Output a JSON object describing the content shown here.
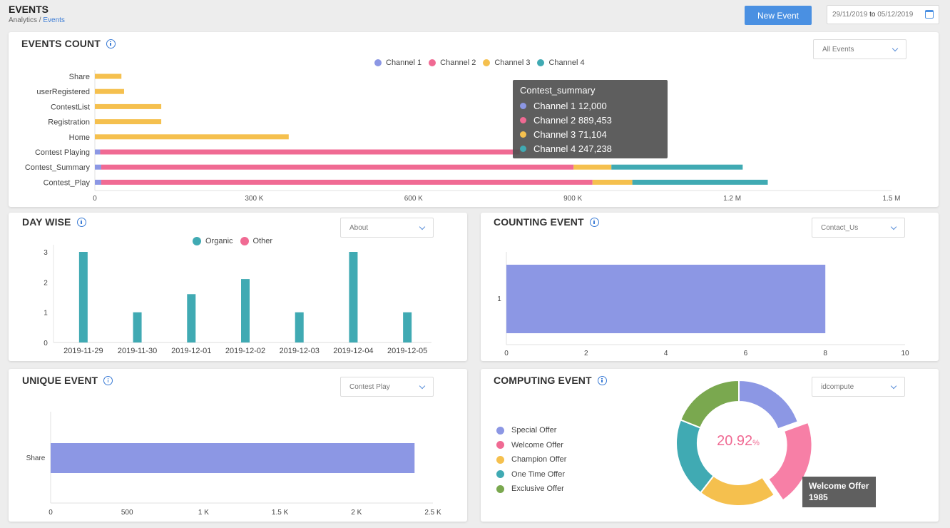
{
  "header": {
    "title": "EVENTS",
    "breadcrumb_root": "Analytics / ",
    "breadcrumb_current": "Events",
    "new_event_label": "New Event",
    "date_from": "29/11/2019",
    "date_to_word": "to",
    "date_to": "05/12/2019"
  },
  "colors": {
    "channel1": "#8c97e4",
    "channel2": "#f06a93",
    "channel3": "#f5c04e",
    "channel4": "#40aab3",
    "organic": "#40aab3",
    "other": "#f06a93",
    "bar_blue": "#8c97e4",
    "accent": "#4a90e2",
    "special": "#8c97e4",
    "welcome": "#f77fa6",
    "champion": "#f5c04e",
    "one_time": "#40aab3",
    "exclusive": "#7aa84f"
  },
  "events_count": {
    "title": "EVENTS COUNT",
    "select_value": "All Events",
    "tooltip": {
      "title": "Contest_summary",
      "rows": [
        {
          "name": "Channel 1",
          "value": "12,000"
        },
        {
          "name": "Channel 2",
          "value": "889,453"
        },
        {
          "name": "Channel 3",
          "value": "71,104"
        },
        {
          "name": "Channel 4",
          "value": "247,238"
        }
      ]
    }
  },
  "day_wise": {
    "title": "DAY WISE",
    "select_value": "About"
  },
  "counting_event": {
    "title": "COUNTING EVENT",
    "select_value": "Contact_Us"
  },
  "unique_event": {
    "title": "UNIQUE EVENT",
    "select_value": "Contest Play"
  },
  "computing_event": {
    "title": "COMPUTING EVENT",
    "select_value": "idcompute",
    "center_value": "20.92",
    "center_unit": "%",
    "tooltip_label": "Welcome Offer",
    "tooltip_value": "1985"
  },
  "chart_data": [
    {
      "type": "bar",
      "orientation": "horizontal",
      "stacked": true,
      "title": "EVENTS COUNT",
      "categories": [
        "Share",
        "userRegistered",
        "ContestList",
        "Registration",
        "Home",
        "Contest Playing",
        "Contest_Summary",
        "Contest_Play"
      ],
      "series": [
        {
          "name": "Channel 1",
          "values": [
            0,
            0,
            0,
            0,
            0,
            10000,
            12000,
            12000
          ]
        },
        {
          "name": "Channel 2",
          "values": [
            0,
            0,
            0,
            0,
            0,
            790000,
            889453,
            925000
          ]
        },
        {
          "name": "Channel 3",
          "values": [
            50000,
            55000,
            125000,
            125000,
            365000,
            0,
            71104,
            75000
          ]
        },
        {
          "name": "Channel 4",
          "values": [
            0,
            0,
            0,
            0,
            0,
            0,
            247238,
            255000
          ]
        }
      ],
      "xlim": [
        0,
        1500000
      ],
      "xticks": [
        "0",
        "300 K",
        "600 K",
        "900 K",
        "1.2 M",
        "1.5 M"
      ],
      "legend_position": "top"
    },
    {
      "type": "bar",
      "title": "DAY WISE",
      "categories": [
        "2019-11-29",
        "2019-11-30",
        "2019-12-01",
        "2019-12-02",
        "2019-12-03",
        "2019-12-04",
        "2019-12-05"
      ],
      "series": [
        {
          "name": "Organic",
          "values": [
            3,
            1,
            1.6,
            2.1,
            1,
            3,
            1
          ]
        },
        {
          "name": "Other",
          "values": [
            0,
            0,
            0,
            0,
            0,
            0,
            0
          ]
        }
      ],
      "ylim": [
        0,
        3
      ],
      "yticks": [
        "0",
        "1",
        "2",
        "3"
      ],
      "legend_position": "top"
    },
    {
      "type": "bar",
      "orientation": "horizontal",
      "title": "COUNTING EVENT",
      "categories": [
        "1"
      ],
      "values": [
        8
      ],
      "xlim": [
        0,
        10
      ],
      "xticks": [
        "0",
        "2",
        "4",
        "6",
        "8",
        "10"
      ]
    },
    {
      "type": "bar",
      "orientation": "horizontal",
      "title": "UNIQUE EVENT",
      "categories": [
        "Share"
      ],
      "values": [
        2380
      ],
      "xlim": [
        0,
        2500
      ],
      "xticks": [
        "0",
        "500",
        "1 K",
        "1.5 K",
        "2 K",
        "2.5 K"
      ]
    },
    {
      "type": "pie",
      "donut": true,
      "title": "COMPUTING EVENT",
      "labels": [
        "Special Offer",
        "Welcome Offer",
        "Champion Offer",
        "One Time Offer",
        "Exclusive Offer"
      ],
      "values": [
        1850,
        1985,
        1900,
        1950,
        1800
      ],
      "legend_position": "left"
    }
  ]
}
